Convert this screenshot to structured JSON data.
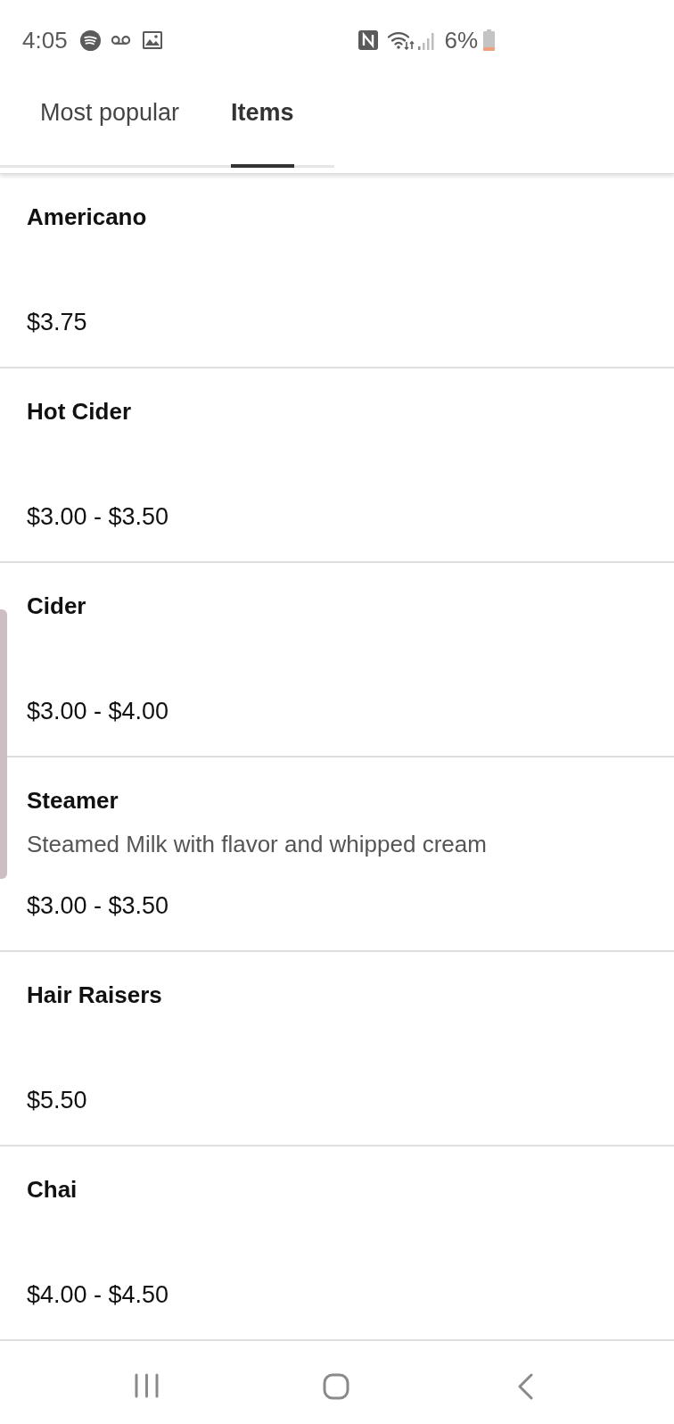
{
  "status_bar": {
    "time": "4:05",
    "battery": "6%"
  },
  "tabs": [
    {
      "label": "Most popular",
      "selected": false
    },
    {
      "label": "Items",
      "selected": true
    }
  ],
  "items": [
    {
      "name": "Americano",
      "price": "$3.75"
    },
    {
      "name": "Hot Cider",
      "price": "$3.00 - $3.50"
    },
    {
      "name": "Cider",
      "price": "$3.00 - $4.00"
    },
    {
      "name": "Steamer",
      "description": "Steamed Milk with flavor and whipped cream",
      "price": "$3.00 - $3.50"
    },
    {
      "name": "Hair Raisers",
      "price": "$5.50"
    },
    {
      "name": "Chai",
      "price": "$4.00 - $4.50"
    }
  ]
}
